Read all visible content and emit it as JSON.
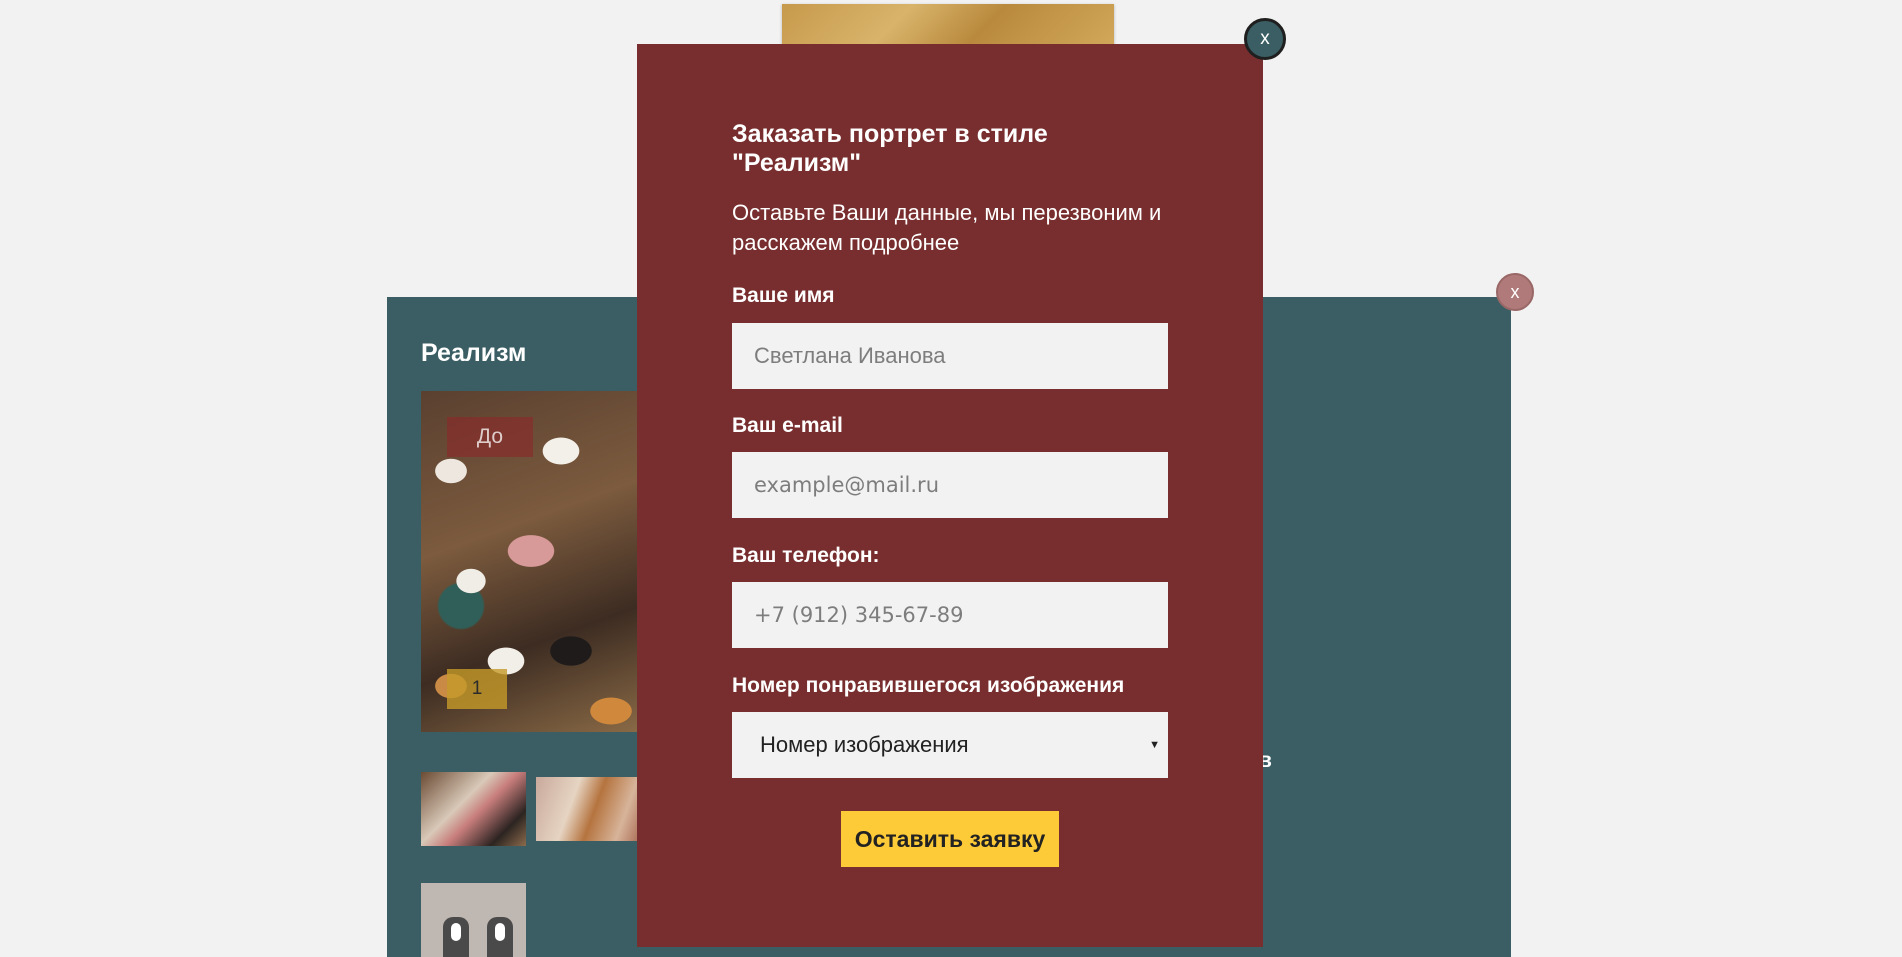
{
  "background_panel": {
    "title": "Реализм",
    "before_label": "До",
    "image_number": "1",
    "partial_text": "в",
    "close_label": "x"
  },
  "modal": {
    "close_label": "x",
    "title": "Заказать портрет в стиле \"Реализм\"",
    "subtitle": "Оставьте Ваши данные, мы перезвоним и расскажем подробнее",
    "fields": {
      "name": {
        "label": "Ваше имя",
        "placeholder": "Светлана Иванова"
      },
      "email": {
        "label": "Ваш e-mail",
        "placeholder": "example@mail.ru"
      },
      "phone": {
        "label": "Ваш телефон:",
        "placeholder": "+7 (912) 345-67-89"
      },
      "image_number": {
        "label": "Номер понравившегося изображения",
        "selected": "Номер изображения"
      }
    },
    "submit_label": "Оставить заявку"
  },
  "colors": {
    "modal_bg": "#782e2e",
    "panel_bg": "#3a5e63",
    "page_bg": "#f2f2f2",
    "submit_bg": "#fdcb37"
  },
  "icons": {
    "select_caret": "caret-down-icon"
  }
}
